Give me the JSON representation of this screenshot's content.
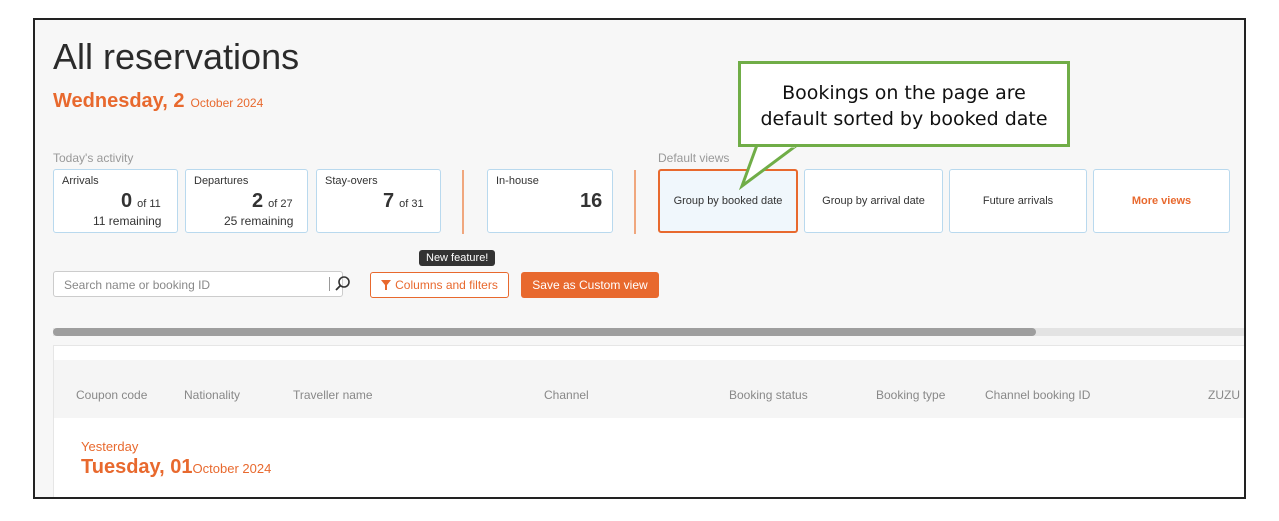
{
  "page": {
    "title": "All reservations",
    "date_day": "Wednesday, 2",
    "date_month": "October 2024"
  },
  "activity": {
    "section_label": "Today's activity",
    "arrivals": {
      "label": "Arrivals",
      "value": "0",
      "of": "of 11",
      "remaining": "11 remaining"
    },
    "departures": {
      "label": "Departures",
      "value": "2",
      "of": "of 27",
      "remaining": "25 remaining"
    },
    "stayovers": {
      "label": "Stay-overs",
      "value": "7",
      "of": "of 31"
    },
    "inhouse": {
      "label": "In-house",
      "value": "16"
    }
  },
  "views": {
    "section_label": "Default views",
    "items": [
      {
        "label": "Group by booked date",
        "active": true
      },
      {
        "label": "Group by arrival date"
      },
      {
        "label": "Future arrivals"
      },
      {
        "label": "More views"
      }
    ]
  },
  "toolbar": {
    "search_placeholder": "Search name or booking ID",
    "tooltip": "New feature!",
    "filter_label": "Columns and filters",
    "save_label": "Save as Custom view"
  },
  "table": {
    "columns": [
      "Coupon code",
      "Nationality",
      "Traveller name",
      "Channel",
      "Booking status",
      "Booking type",
      "Channel booking ID",
      "ZUZU r"
    ],
    "group": {
      "relative": "Yesterday",
      "day": "Tuesday, 01",
      "month": "October 2024"
    }
  },
  "callout": {
    "line1": "Bookings on the page are",
    "line2": "default sorted by booked date"
  },
  "colors": {
    "accent": "#e8692e",
    "callout_border": "#70ad47",
    "card_border": "#b9d9ee"
  }
}
